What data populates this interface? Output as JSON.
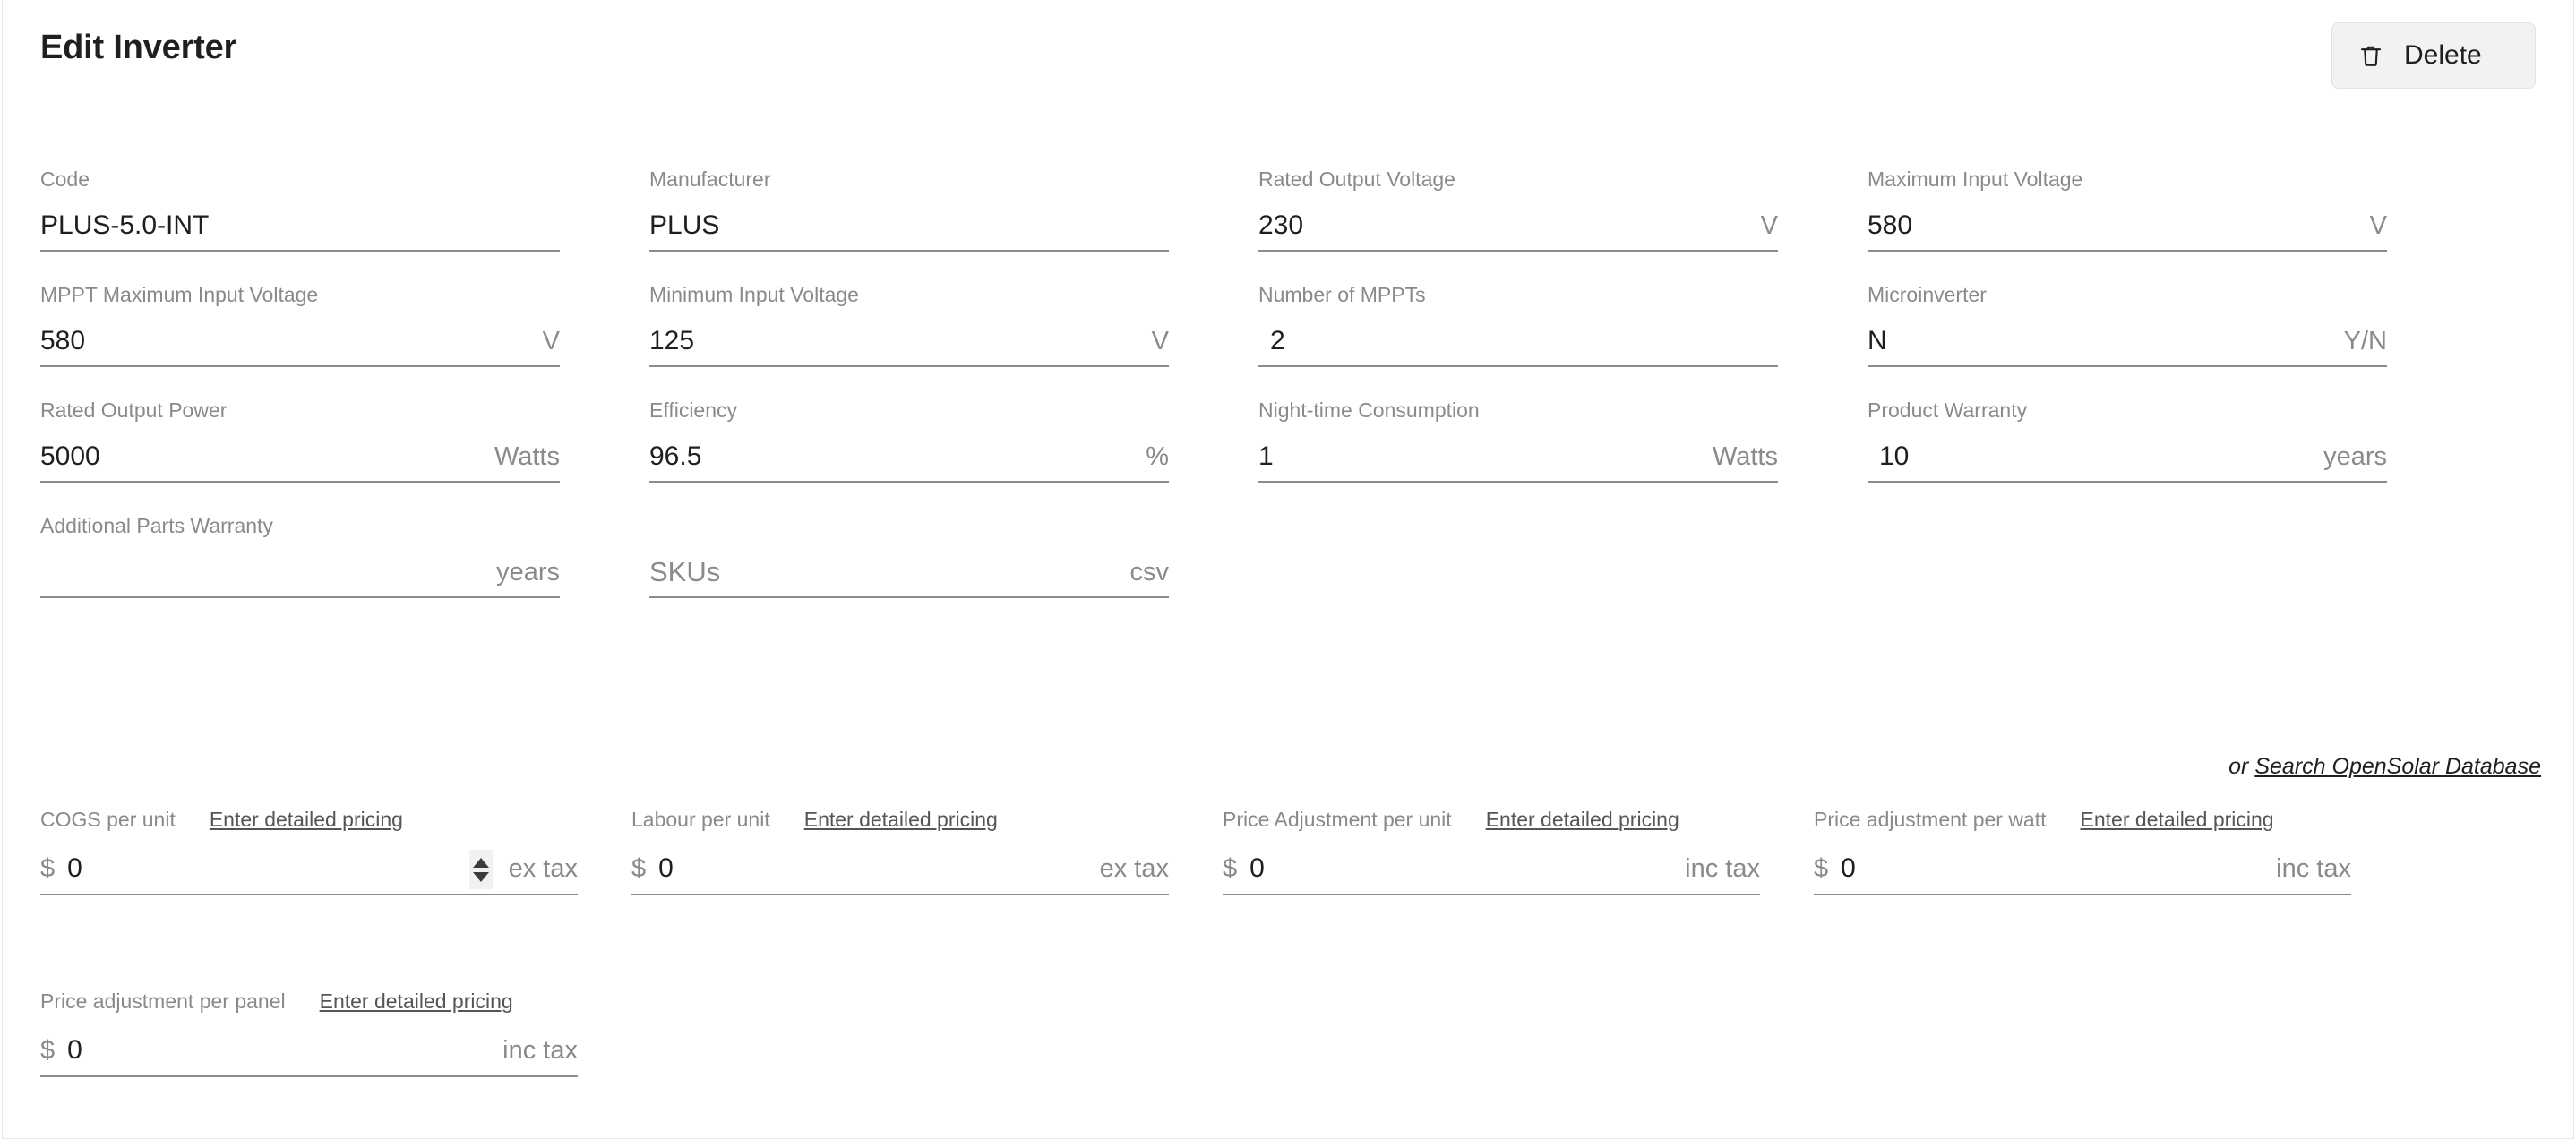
{
  "header": {
    "title": "Edit Inverter",
    "delete_label": "Delete",
    "delete_icon": "trash-icon"
  },
  "specs": {
    "rows": [
      [
        {
          "label": "Code",
          "value": "PLUS-5.0-INT",
          "suffix": "",
          "indent": false,
          "placeholder": false
        },
        {
          "label": "Manufacturer",
          "value": "PLUS",
          "suffix": "",
          "indent": false,
          "placeholder": false
        },
        {
          "label": "Rated Output Voltage",
          "value": "230",
          "suffix": "V",
          "indent": false,
          "placeholder": false
        },
        {
          "label": "Maximum Input Voltage",
          "value": "580",
          "suffix": "V",
          "indent": false,
          "placeholder": false
        }
      ],
      [
        {
          "label": "MPPT Maximum Input Voltage",
          "value": "580",
          "suffix": "V",
          "indent": false,
          "placeholder": false
        },
        {
          "label": "Minimum Input Voltage",
          "value": "125",
          "suffix": "V",
          "indent": false,
          "placeholder": false
        },
        {
          "label": "Number of MPPTs",
          "value": "2",
          "suffix": "",
          "indent": true,
          "placeholder": false
        },
        {
          "label": "Microinverter",
          "value": "N",
          "suffix": "Y/N",
          "indent": false,
          "placeholder": false
        }
      ],
      [
        {
          "label": "Rated Output Power",
          "value": "5000",
          "suffix": "Watts",
          "indent": false,
          "placeholder": false
        },
        {
          "label": "Efficiency",
          "value": "96.5",
          "suffix": "%",
          "indent": false,
          "placeholder": false
        },
        {
          "label": "Night-time Consumption",
          "value": "1",
          "suffix": "Watts",
          "indent": false,
          "placeholder": false
        },
        {
          "label": "Product Warranty",
          "value": "10",
          "suffix": "years",
          "indent": true,
          "placeholder": false
        }
      ],
      [
        {
          "label": "Additional Parts Warranty",
          "value": "",
          "suffix": "years",
          "indent": false,
          "placeholder": false
        },
        {
          "label": "",
          "value": "SKUs",
          "suffix": "csv",
          "indent": false,
          "placeholder": true
        },
        {
          "label": "",
          "value": "",
          "suffix": "",
          "indent": false,
          "placeholder": false,
          "hidden": true
        },
        {
          "label": "",
          "value": "",
          "suffix": "",
          "indent": false,
          "placeholder": false,
          "hidden": true
        }
      ]
    ]
  },
  "db_search": {
    "or_text": "or",
    "link_text": "Search OpenSolar Database"
  },
  "pricing": {
    "detailed_pricing_link": "Enter detailed pricing",
    "currency_symbol": "$",
    "rows": [
      [
        {
          "label": "COGS per unit",
          "link": "Enter detailed pricing",
          "value": "0",
          "tax": "ex tax",
          "spinner": true
        },
        {
          "label": "Labour per unit",
          "link": "Enter detailed pricing",
          "value": "0",
          "tax": "ex tax",
          "spinner": false
        },
        {
          "label": "Price Adjustment per unit",
          "link": "Enter detailed pricing",
          "value": "0",
          "tax": "inc tax",
          "spinner": false
        },
        {
          "label": "Price adjustment per watt",
          "link": "Enter detailed pricing",
          "value": "0",
          "tax": "inc tax",
          "spinner": false
        }
      ],
      [
        {
          "label": "Price adjustment per panel",
          "link": "Enter detailed pricing",
          "value": "0",
          "tax": "inc tax",
          "spinner": false
        }
      ]
    ]
  },
  "colors": {
    "label": "#8a8a8a",
    "value": "#1f1f1f",
    "underline": "#8c8c8c",
    "button_bg": "#f2f2f2"
  }
}
